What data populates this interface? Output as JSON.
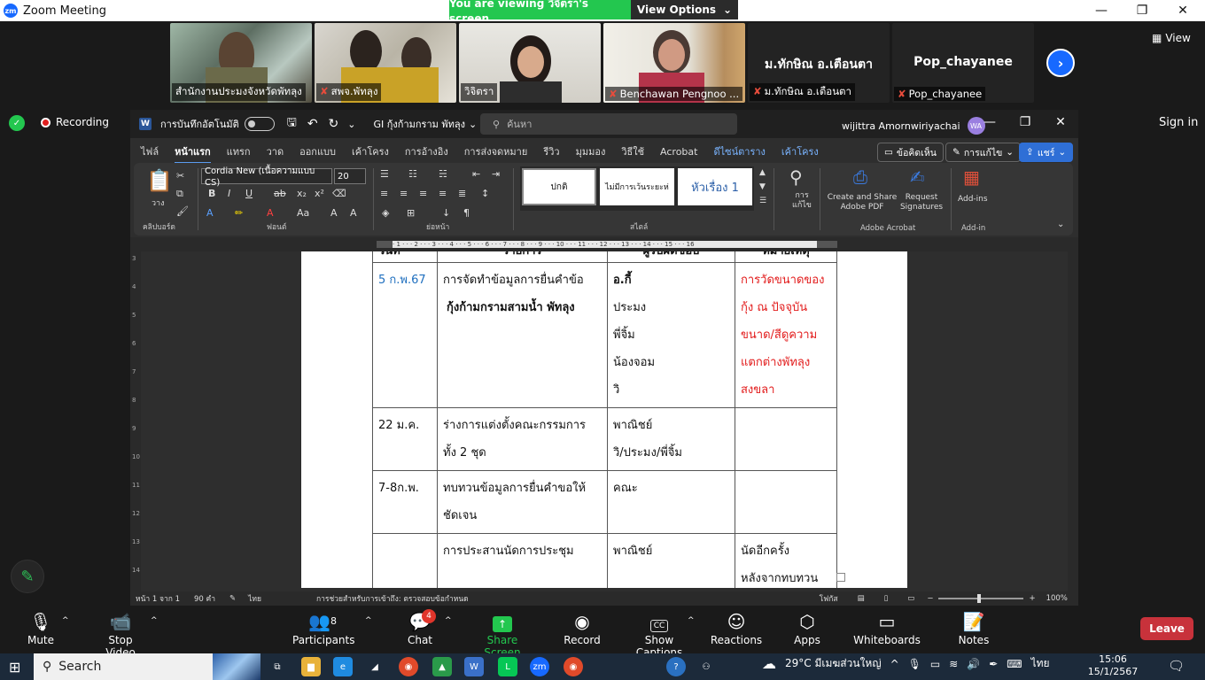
{
  "zoom": {
    "window_title": "Zoom Meeting",
    "banner_viewing": "You are viewing วิจิตรา's screen",
    "banner_options": "View Options",
    "view_label": "View",
    "recording_label": "Recording",
    "signin_label": "Sign in",
    "leave_label": "Leave",
    "participants": [
      {
        "name": "สำนักงานประมงจังหวัดพัทลุง",
        "muted": false
      },
      {
        "name": "สพจ.พัทลุง",
        "muted": true
      },
      {
        "name": "วิจิตรา",
        "muted": false
      },
      {
        "name": "Benchawan Pengnoo ...",
        "muted": true
      },
      {
        "name": "ม.ทักษิณ อ.เตือนตา",
        "muted": true,
        "display": "ม.ทักษิณ อ.เตือนตา"
      },
      {
        "name": "Pop_chayanee",
        "muted": true,
        "display": "Pop_chayanee"
      }
    ],
    "toolbar": {
      "mute": "Mute",
      "stop_video": "Stop Video",
      "participants": "Participants",
      "participants_count": "8",
      "chat": "Chat",
      "chat_badge": "4",
      "share_screen": "Share Screen",
      "record": "Record",
      "show_captions": "Show Captions",
      "captions_icon": "CC",
      "reactions": "Reactions",
      "apps": "Apps",
      "whiteboards": "Whiteboards",
      "notes": "Notes"
    }
  },
  "word": {
    "autosave_label": "การบันทึกอัตโนมัติ",
    "doc_title": "GI กุ้งก้ามกราม พัทลุง",
    "search_placeholder": "ค้นหา",
    "user_name": "wijittra Amornwiriyachai",
    "user_initials": "WA",
    "tabs": [
      "ไฟล์",
      "หน้าแรก",
      "แทรก",
      "วาด",
      "ออกแบบ",
      "เค้าโครง",
      "การอ้างอิง",
      "การส่งจดหมาย",
      "รีวิว",
      "มุมมอง",
      "วิธีใช้",
      "Acrobat",
      "ดีไซน์ตาราง",
      "เค้าโครง"
    ],
    "comments_btn": "ข้อคิดเห็น",
    "editing_btn": "การแก้ไข",
    "share_btn": "แชร์",
    "ribbon": {
      "paste": "วาง",
      "clipboard": "คลิปบอร์ด",
      "font_name": "Cordia New (เนื้อความแบบ CS)",
      "font_size": "20",
      "font_group": "ฟอนต์",
      "paragraph_group": "ย่อหน้า",
      "styles": [
        "ปกติ",
        "ไม่มีการเว้นระยะห่",
        "หัวเรื่อง 1"
      ],
      "styles_group": "สไตล์",
      "find": "การ แก้ไข",
      "create_pdf": "Create and Share Adobe PDF",
      "request_sig": "Request Signatures",
      "acrobat_group": "Adobe Acrobat",
      "addins": "Add-ins",
      "addins_group": "Add-in"
    },
    "ruler_text": "· 1 · · · 2 · · · 3 · · · 4 · · · 5 · · · 6 · · · 7 · · · 8 · · · 9 · · · 10 · · · 11 · · · 12 · · · 13 · · · 14 · · · 15 · · · 16",
    "vruler": [
      "3",
      "4",
      "5",
      "6",
      "7",
      "8",
      "9",
      "10",
      "11",
      "12",
      "13",
      "14"
    ],
    "header_row": [
      "วันที่",
      "รายการ",
      "ผู้รับผิดชอบ",
      "หมายเหตุ"
    ],
    "rows": [
      {
        "date": "5 ก.พ.67",
        "item": [
          "การจัดทำข้อมูลการยื่นคำข้อ",
          "กุ้งก้ามกรามสามน้ำ พัทลุง"
        ],
        "owner": [
          "อ.กี้",
          "ประมง",
          "พี่จิ้ม",
          "น้องจอม",
          "วิ"
        ],
        "note": [
          "การวัดขนาดของ",
          "กุ้ง ณ ปัจจุบัน",
          "ขนาด/สีดูความ",
          "แตกต่างพัทลุง",
          "สงขลา"
        ]
      },
      {
        "date": "22 ม.ค.",
        "item": [
          "ร่างการแต่งตั้งคณะกรรมการ",
          "ทั้ง 2 ชุด"
        ],
        "owner": [
          "พาณิชย์",
          "วิ/ประมง/พี่จิ้ม"
        ],
        "note": []
      },
      {
        "date": "7-8ก.พ.",
        "item": [
          "ทบทวนข้อมูลการยื่นคำขอให้",
          "ชัดเจน"
        ],
        "owner": [
          "คณะ"
        ],
        "note": []
      },
      {
        "date": "",
        "item": [
          "การประสานนัดการประชุม"
        ],
        "owner": [
          "พาณิชย์"
        ],
        "note": [
          "นัดอีกครั้ง",
          "หลังจากทบทวน"
        ]
      }
    ],
    "status": {
      "page": "หน้า 1 จาก 1",
      "words": "90 คำ",
      "lang": "ไทย",
      "accessibility": "การช่วยสำหรับการเข้าถึง: ตรวจสอบข้อกำหนด",
      "focus": "โฟกัส",
      "zoom": "100%"
    }
  },
  "taskbar": {
    "search": "Search",
    "weather": "29°C มีเมฆส่วนใหญ่",
    "lang": "ไทย",
    "time": "15:06",
    "date": "15/1/2567"
  },
  "colors": {
    "zoom_green": "#23c74f",
    "zoom_blue": "#1769ff",
    "leave_red": "#c8323b",
    "doc_red": "#e21b1b",
    "doc_blue": "#1f6fbf"
  }
}
